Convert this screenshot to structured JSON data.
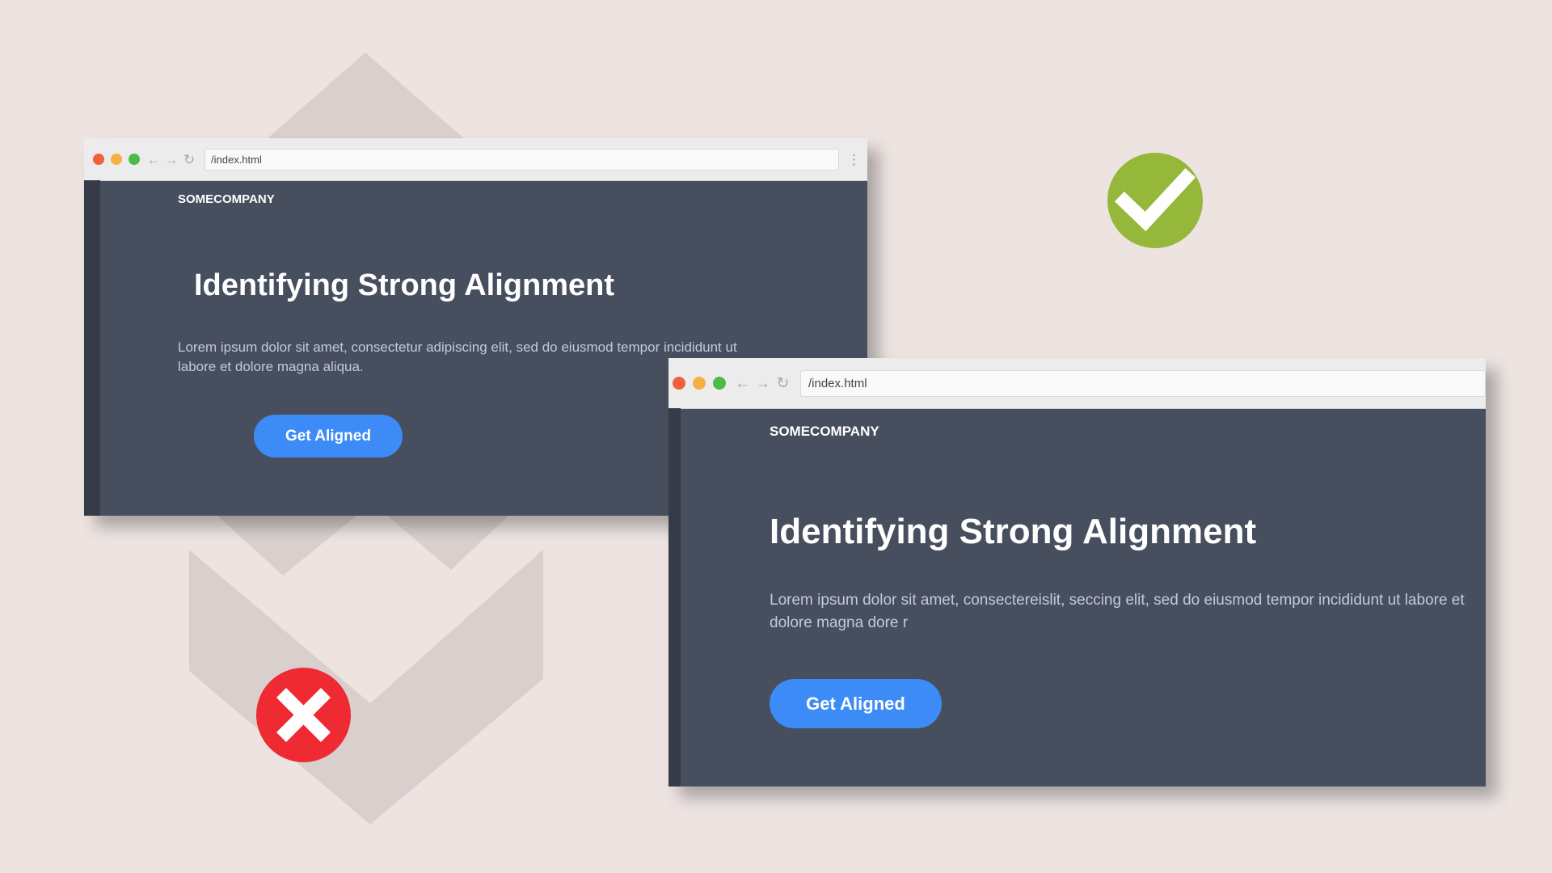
{
  "colors": {
    "background": "#ede3e1",
    "page_bg": "#474f5e",
    "sidebar": "#353c48",
    "accent": "#3d8bf7",
    "check": "#95b73a",
    "cross": "#ef2a33"
  },
  "browser_bad": {
    "url": "/index.html",
    "brand": "SOMECOMPANY",
    "headline": "Identifying Strong Alignment",
    "body": "Lorem ipsum dolor sit amet, consectetur adipiscing elit, sed do eiusmod tempor incididunt ut labore et dolore magna aliqua.",
    "cta_label": "Get Aligned",
    "nav_back": "←",
    "nav_forward": "→",
    "nav_reload": "↻",
    "menu": "⋮"
  },
  "browser_good": {
    "url": "/index.html",
    "brand": "SOMECOMPANY",
    "headline": "Identifying Strong Alignment",
    "body": "Lorem ipsum dolor sit amet, consectereislit, seccing elit, sed do eiusmod tempor incididunt ut labore et dolore magna dore r",
    "cta_label": "Get Aligned",
    "nav_back": "←",
    "nav_forward": "→",
    "nav_reload": "↻"
  },
  "icons": {
    "check": "checkmark-icon",
    "cross": "cross-icon"
  }
}
